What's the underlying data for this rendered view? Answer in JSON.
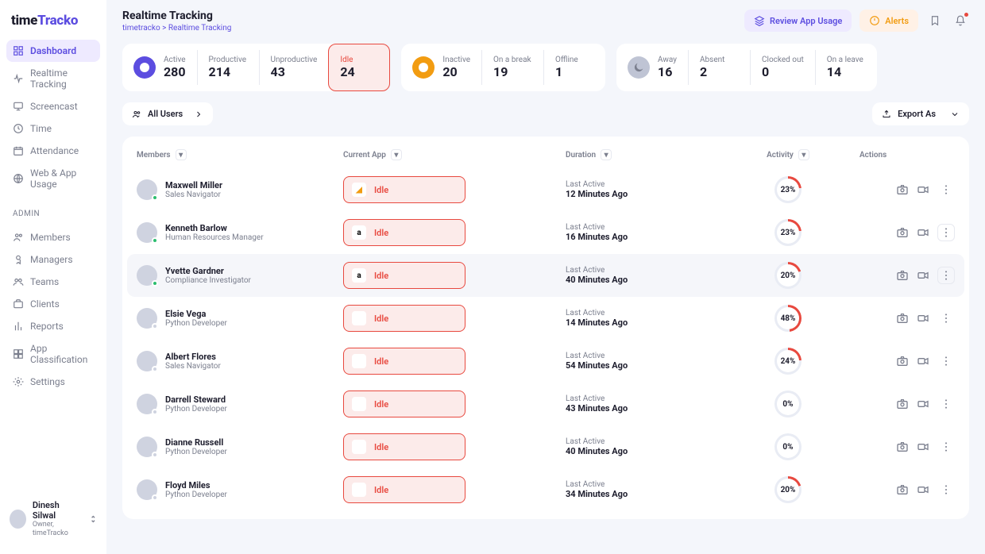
{
  "brand": {
    "a": "time",
    "b": "Tracko"
  },
  "nav": [
    {
      "label": "Dashboard",
      "icon": "dashboard",
      "active": true
    },
    {
      "label": "Realtime Tracking",
      "icon": "pulse"
    },
    {
      "label": "Screencast",
      "icon": "monitor"
    },
    {
      "label": "Time",
      "icon": "clock"
    },
    {
      "label": "Attendance",
      "icon": "calendar"
    },
    {
      "label": "Web & App Usage",
      "icon": "globe"
    }
  ],
  "admin_label": "ADMIN",
  "admin_nav": [
    {
      "label": "Members",
      "icon": "users"
    },
    {
      "label": "Managers",
      "icon": "badge"
    },
    {
      "label": "Teams",
      "icon": "team"
    },
    {
      "label": "Clients",
      "icon": "briefcase"
    },
    {
      "label": "Reports",
      "icon": "report"
    },
    {
      "label": "App Classification",
      "icon": "grid"
    },
    {
      "label": "Settings",
      "icon": "gear"
    }
  ],
  "current_user": {
    "name": "Dinesh Silwal",
    "role": "Owner, timeTracko"
  },
  "page": {
    "title": "Realtime Tracking",
    "breadcrumb": "timetracko > Realtime Tracking"
  },
  "top_actions": {
    "review": "Review App Usage",
    "alerts": "Alerts"
  },
  "stat_groups": [
    {
      "icon": "check",
      "icon_color": "purple",
      "items": [
        {
          "label": "Active",
          "value": "280"
        },
        {
          "label": "Productive",
          "value": "214"
        },
        {
          "label": "Unproductive",
          "value": "43"
        },
        {
          "label": "Idle",
          "value": "24",
          "highlight": true
        }
      ]
    },
    {
      "icon": "clock-fill",
      "icon_color": "orange",
      "items": [
        {
          "label": "Inactive",
          "value": "20"
        },
        {
          "label": "On a break",
          "value": "19"
        },
        {
          "label": "Offline",
          "value": "1"
        }
      ]
    },
    {
      "icon": "moon",
      "icon_color": "grey",
      "items": [
        {
          "label": "Away",
          "value": "16"
        },
        {
          "label": "Absent",
          "value": "2"
        },
        {
          "label": "Clocked out",
          "value": "0"
        },
        {
          "label": "On a leave",
          "value": "14"
        }
      ]
    }
  ],
  "toolbar": {
    "filter": "All Users",
    "export": "Export As"
  },
  "columns": {
    "members": "Members",
    "app": "Current App",
    "duration": "Duration",
    "activity": "Activity",
    "actions": "Actions"
  },
  "last_active_label": "Last Active",
  "rows": [
    {
      "name": "Maxwell Miller",
      "role": "Sales Navigator",
      "app_icon": "analytics",
      "state": "Idle",
      "time": "12 Minutes Ago",
      "pct": 23,
      "status": "green"
    },
    {
      "name": "Kenneth Barlow",
      "role": "Human Resources Manager",
      "app_icon": "amazon",
      "state": "Idle",
      "time": "16 Minutes Ago",
      "pct": 23,
      "status": "green",
      "more_boxed": true
    },
    {
      "name": "Yvette Gardner",
      "role": "Compliance Investigator",
      "app_icon": "amazon",
      "state": "Idle",
      "time": "40 Minutes Ago",
      "pct": 20,
      "status": "green",
      "hover": true,
      "more_boxed": true
    },
    {
      "name": "Elsie Vega",
      "role": "Python Developer",
      "app_icon": "",
      "state": "Idle",
      "time": "14 Minutes Ago",
      "pct": 48,
      "status": "grey"
    },
    {
      "name": "Albert Flores",
      "role": "Sales Navigator",
      "app_icon": "",
      "state": "Idle",
      "time": "54 Minutes Ago",
      "pct": 24,
      "status": "grey"
    },
    {
      "name": "Darrell Steward",
      "role": "Python Developer",
      "app_icon": "",
      "state": "Idle",
      "time": "43 Minutes Ago",
      "pct": 0,
      "status": "grey"
    },
    {
      "name": "Dianne Russell",
      "role": "Python Developer",
      "app_icon": "",
      "state": "Idle",
      "time": "40 Minutes Ago",
      "pct": 0,
      "status": "grey"
    },
    {
      "name": "Floyd Miles",
      "role": "Python Developer",
      "app_icon": "",
      "state": "Idle",
      "time": "34 Minutes Ago",
      "pct": 20,
      "status": "grey"
    }
  ]
}
